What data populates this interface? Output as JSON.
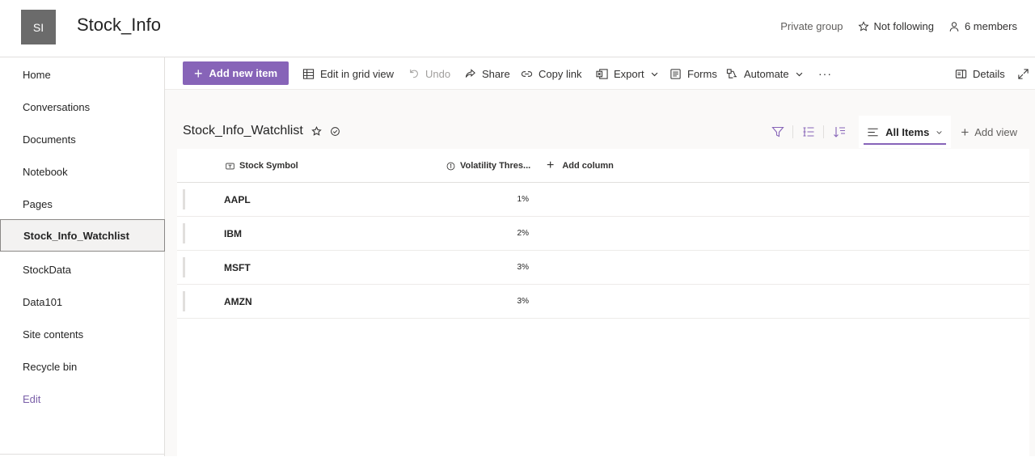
{
  "header": {
    "logo_initials": "SI",
    "site_title": "Stock_Info",
    "privacy": "Private group",
    "follow_label": "Not following",
    "members_label": "6 members"
  },
  "sidebar": {
    "items": [
      {
        "label": "Home"
      },
      {
        "label": "Conversations"
      },
      {
        "label": "Documents"
      },
      {
        "label": "Notebook"
      },
      {
        "label": "Pages"
      },
      {
        "label": "Stock_Info_Watchlist"
      },
      {
        "label": "StockData"
      },
      {
        "label": "Data101"
      },
      {
        "label": "Site contents"
      },
      {
        "label": "Recycle bin"
      }
    ],
    "edit_label": "Edit"
  },
  "commands": {
    "add_new": "Add new item",
    "grid_view": "Edit in grid view",
    "undo": "Undo",
    "share": "Share",
    "copy_link": "Copy link",
    "export": "Export",
    "forms": "Forms",
    "automate": "Automate",
    "more": "···",
    "details": "Details"
  },
  "list": {
    "title": "Stock_Info_Watchlist",
    "view_name": "All Items",
    "add_view": "Add view",
    "columns": {
      "symbol": "Stock Symbol",
      "volatility": "Volatility Thres...",
      "add_column": "Add column"
    },
    "rows": [
      {
        "symbol": "AAPL",
        "volatility": "1%"
      },
      {
        "symbol": "IBM",
        "volatility": "2%"
      },
      {
        "symbol": "MSFT",
        "volatility": "3%"
      },
      {
        "symbol": "AMZN",
        "volatility": "3%"
      }
    ]
  },
  "colors": {
    "accent": "#8764b8",
    "logo_bg": "#6b6b6b"
  }
}
